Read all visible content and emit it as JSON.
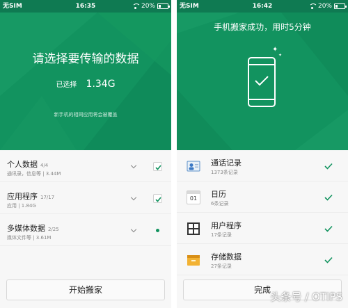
{
  "left_screen": {
    "status_bar": {
      "carrier": "无SIM",
      "time": "16:35",
      "battery": "20%"
    },
    "header": {
      "title": "请选择要传输的数据",
      "selected_label": "已选择",
      "selected_size": "1.34G",
      "note": "新手机的相同应用将会被覆盖"
    },
    "items": [
      {
        "name": "个人数据",
        "count": "4/4",
        "detail": "通讯录，信息等 | 3.44M",
        "control": "check"
      },
      {
        "name": "应用程序",
        "count": "17/17",
        "detail": "应用 | 1.84G",
        "control": "check"
      },
      {
        "name": "多媒体数据",
        "count": "2/25",
        "detail": "媒体文件等 | 3.61M",
        "control": "dot"
      }
    ],
    "button": "开始搬家"
  },
  "right_screen": {
    "status_bar": {
      "carrier": "无SIM",
      "time": "16:42",
      "battery": "20%"
    },
    "header": {
      "title": "手机搬家成功，用时5分钟"
    },
    "items": [
      {
        "name": "通话记录",
        "detail": "1373条记录",
        "icon": "contacts-card-icon"
      },
      {
        "name": "日历",
        "detail": "6条记录",
        "icon": "calendar-icon"
      },
      {
        "name": "用户程序",
        "detail": "17条记录",
        "icon": "apps-grid-icon"
      },
      {
        "name": "存储数据",
        "detail": "27条记录",
        "icon": "storage-box-icon"
      }
    ],
    "button": "完成",
    "calendar_day": "01"
  },
  "watermark": "头条号 / OTIPS",
  "colors": {
    "brand_green": "#12935f",
    "status_green": "#0f7a52",
    "list_bg": "#f7f7f7"
  }
}
